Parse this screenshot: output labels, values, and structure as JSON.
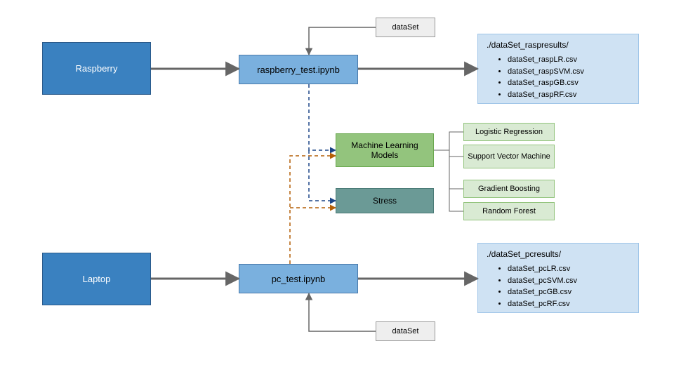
{
  "nodes": {
    "raspberry": "Raspberry",
    "laptop": "Laptop",
    "raspberry_test": "raspberry_test.ipynb",
    "pc_test": "pc_test.ipynb",
    "dataset_top": "dataSet",
    "dataset_bottom": "dataSet",
    "ml_models": "Machine Learning Models",
    "stress": "Stress",
    "lr": "Logistic Regression",
    "svm": "Support Vector Machine",
    "gb": "Gradient Boosting",
    "rf": "Random Forest"
  },
  "rasp_results": {
    "title": "./dataSet_raspresults/",
    "items": [
      "dataSet_raspLR.csv",
      "dataSet_raspSVM.csv",
      "dataSet_raspGB.csv",
      "dataSet_raspRF.csv"
    ]
  },
  "pc_results": {
    "title": "./dataSet_pcresults/",
    "items": [
      "dataSet_pcLR.csv",
      "dataSet_pcSVM.csv",
      "dataSet_pcGB.csv",
      "dataSet_pcRF.csv"
    ]
  },
  "colors": {
    "solid_edge": "#666666",
    "blue_dash": "#1c4587",
    "orange_dash": "#b45f06"
  }
}
